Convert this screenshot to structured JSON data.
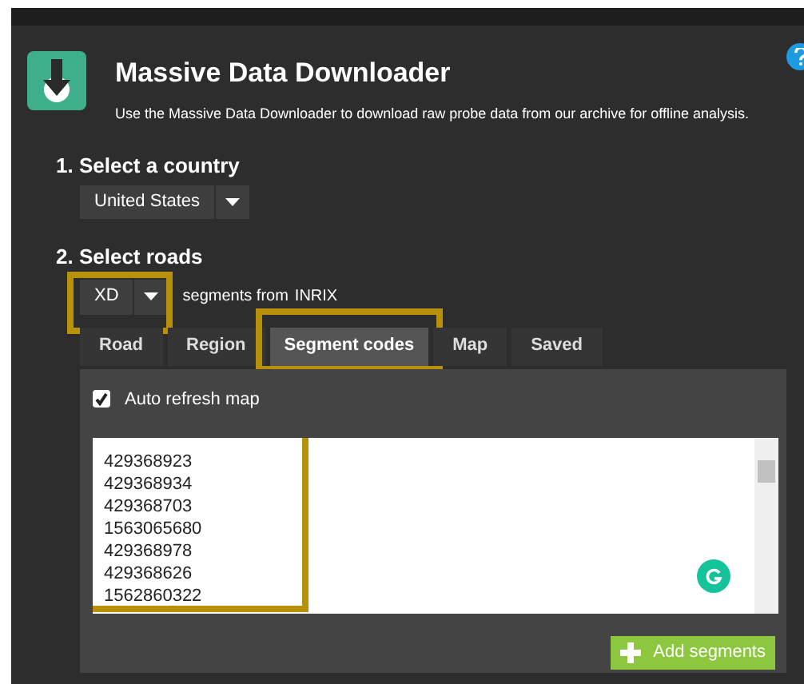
{
  "app": {
    "title": "Massive Data Downloader",
    "description": "Use the Massive Data Downloader to download raw probe data from our archive for offline analysis."
  },
  "country_step": {
    "heading": "1. Select a country",
    "select": {
      "value": "United States"
    }
  },
  "roads_step": {
    "heading": "2. Select roads",
    "select": {
      "value": "XD",
      "highlighted": true
    },
    "source_text": "segments from",
    "source": "INRIX"
  },
  "tabs": [
    {
      "label": "Road",
      "selected": false,
      "highlighted": false
    },
    {
      "label": "Region",
      "selected": false,
      "highlighted": false
    },
    {
      "label": "Segment codes",
      "selected": true,
      "highlighted": true
    },
    {
      "label": "Map",
      "selected": false,
      "highlighted": false
    },
    {
      "label": "Saved",
      "selected": false,
      "highlighted": false
    }
  ],
  "segment_panel": {
    "auto_refresh": {
      "label": "Auto refresh map",
      "checked": true
    },
    "codes_highlighted": true,
    "codes": [
      "429368923",
      "429368934",
      "429368703",
      "1563065680",
      "429368978",
      "429368626",
      "1562860322"
    ],
    "add_button": "Add segments"
  }
}
